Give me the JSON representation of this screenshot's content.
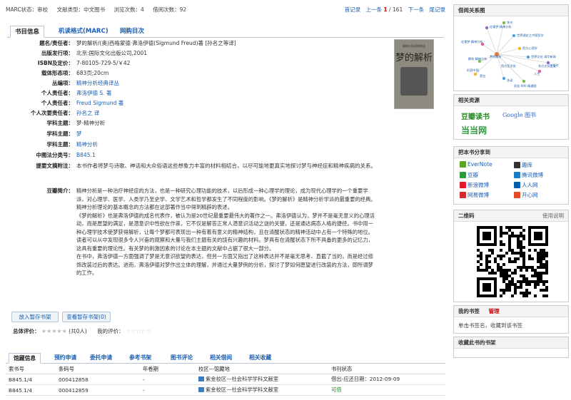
{
  "topbar": {
    "marc_status": "MARC状态：审校",
    "doc_type": "文献类型：中文图书",
    "view_count": "浏览次数：4",
    "borrow_count": "借阅次数：92",
    "first": "首记录",
    "prev": "上一条",
    "current": "1",
    "total": "/ 161",
    "next": "下一条",
    "last": "尾记录"
  },
  "tabs": [
    "书目信息",
    "机读格式(MARC)",
    "网购目次"
  ],
  "fields": [
    {
      "label": "题名/责任者：",
      "value": "梦的解析/(奥)西格蒙德·弗洛伊德(Sigmund Freud)著 [孙名之等译]"
    },
    {
      "label": "出版发行项：",
      "value": "北京:国际文化出版公司,2001"
    },
    {
      "label": "ISBN及定价：",
      "value": "7-80105-729-5/￥42"
    },
    {
      "label": "载体形态项：",
      "value": "683页;20cm"
    },
    {
      "label": "丛编项：",
      "value": "精神分析经典译丛"
    },
    {
      "label": "个人责任者：",
      "value": "弗洛伊德 S. 著"
    },
    {
      "label": "个人责任者：",
      "value": "Freud Sigmund 著"
    },
    {
      "label": "个人次要责任者：",
      "value": "孙名之 译"
    },
    {
      "label": "学科主题：",
      "value": "梦-精神分析"
    },
    {
      "label": "学科主题：",
      "value": "梦"
    },
    {
      "label": "学科主题：",
      "value": "精神分析"
    },
    {
      "label": "中图法分类号：",
      "value": "B845.1"
    },
    {
      "label": "提要文摘附注：",
      "value": "本书作者将梦与诗歌、神话和大众俗语这些想象力丰富的材料相结合，以尽可能地更真实地探讨梦与神经症和精神疾病的关系。"
    }
  ],
  "cover": {
    "title": "梦的解析",
    "series": "精神分析经典译丛"
  },
  "summary": {
    "label": "豆瓣简介：",
    "paragraphs": [
      "精神分析是一种治疗神经症的方法，也是一种研究心理功能的技术，以后形成一种心理学的理论，成为现代心理学的一个重要学派，对心理学、医学、人类学乃至史学、文学艺术和哲学都发生了不同程度的影响。《梦的解析》是精神分析学派的最重要的经典。精神分析理论的基本概念的方法都在这部著作当中得到精辟的表述。",
      "《梦的解析》也是弗洛伊德的成名代表作，被认为是20世纪最重要最伟大的著作之一。弗洛伊德认为，梦并不是毫无意义的心理活动，而是愿望的满足，是潜意识中性欲在作祟，它不仅是解答正常人潜意识活动之谜的关键，还是通达病态人格的捷径。书中用一种心理学技术使梦获得解析，让每个梦都可表现出一种有着有意义的精神结构，且在清醒状态的精神活动中占有一个特殊的地位。读者可以从中发现很多令人兴奋的观察和大量与我们主题有关的饶有兴趣的材料。梦具有在清醒状态下所不具备的更多的记忆力，这具有重要的理论性。有关梦的刺激因素的讨论在本主题的文献中占据了很大一部分。",
      "在书中，弗洛伊德一方面强调了梦是无意识欲望的表达，但另一方面又指出了这种表达并不是毫无思考、直截了当的，而是经过修饰改装过后的表达。进而，弗洛伊德对梦作出立体的理解，并通过大量梦例的分析，探讨了梦如何愿望进行改装的方法，即所谓梦的工作。"
    ]
  },
  "buttons": {
    "add_shelf": "放入暂存书架",
    "view_shelf": "查看暂存书架(0)"
  },
  "rating": {
    "overall_label": "总体评价：",
    "count": "(共0人)",
    "my_label": "我的评价："
  },
  "holding_tabs": [
    "馆藏信息",
    "预约申请",
    "委托申请",
    "参考书架",
    "图书评论",
    "相关借阅",
    "相关收藏"
  ],
  "holding_table": {
    "headers": [
      "索书号",
      "条码号",
      "年卷期",
      "校区—馆藏地",
      "书刊状态"
    ],
    "rows": [
      {
        "call": "B845.1/4",
        "barcode": "000412858",
        "issue": "-",
        "location": "紫金校区—社会科学学科文献室",
        "status": "借出-应还日期：2012-09-09"
      },
      {
        "call": "B845.1/4",
        "barcode": "000412859",
        "issue": "-",
        "location": "紫金校区—社会科学学科文献室",
        "status": "可借"
      }
    ]
  },
  "sidebar": {
    "graph_title": "借阅关系图",
    "graph_labels": [
      "红楼梦 精神分析",
      "世界通史之中国哲学",
      "李光",
      "红楼梦 精神分析",
      "西方心理学",
      "世界文化 清华新闻 ",
      "张爱玲",
      "解析 精神分析",
      "人生",
      "梦的解析",
      "西方哲学史",
      "形容中国",
      "东方文化之史",
      "第五",
      "选读",
      "男女 600 精通图"
    ],
    "resources_title": "相关资源",
    "resources": {
      "douban": "豆瓣读书",
      "google": "Google 图书",
      "dangdang": "当当网"
    },
    "share_title": "把本书分享到",
    "share": [
      {
        "name": "EverNote",
        "color": "#5ba525"
      },
      {
        "name": "趣库",
        "color": "#333333"
      },
      {
        "name": "豆瓣",
        "color": "#2d9a3e"
      },
      {
        "name": "腾讯微博",
        "color": "#1f7bc1"
      },
      {
        "name": "新浪微博",
        "color": "#e6162d"
      },
      {
        "name": "人人网",
        "color": "#005eac"
      },
      {
        "name": "网易微博",
        "color": "#d22c2c"
      },
      {
        "name": "开心网",
        "color": "#e24b28"
      }
    ],
    "qr_title": "二维码",
    "qr_help": "使用说明",
    "tags_title": "我的书签",
    "tags_manage": "管理",
    "tags_text": "单击书签名，收藏到该书签",
    "collect_title": "收藏此书的书架"
  }
}
